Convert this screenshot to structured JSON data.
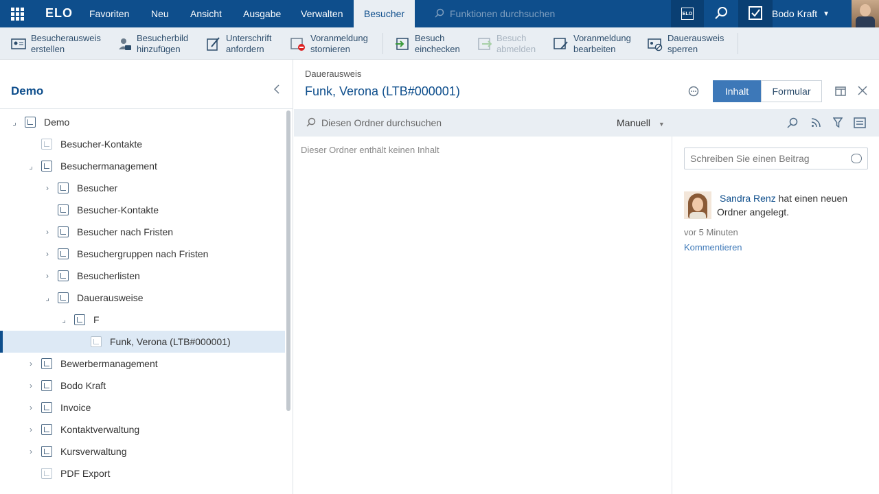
{
  "topbar": {
    "logo": "ELO",
    "menu": [
      "Favoriten",
      "Neu",
      "Ansicht",
      "Ausgabe",
      "Verwalten",
      "Besucher"
    ],
    "active_menu": "Besucher",
    "search_placeholder": "Funktionen durchsuchen",
    "elo_badge": "ELO",
    "user": "Bodo Kraft"
  },
  "toolbar": {
    "buttons": [
      {
        "label": "Besucherausweis\nerstellen",
        "enabled": true
      },
      {
        "label": "Besucherbild\nhinzufügen",
        "enabled": true
      },
      {
        "label": "Unterschrift\nanfordern",
        "enabled": true
      },
      {
        "label": "Voranmeldung\nstornieren",
        "enabled": true
      },
      {
        "label": "Besuch\neinchecken",
        "enabled": true
      },
      {
        "label": "Besuch\nabmelden",
        "enabled": false
      },
      {
        "label": "Voranmeldung\nbearbeiten",
        "enabled": true
      },
      {
        "label": "Dauerausweis\nsperren",
        "enabled": true
      }
    ]
  },
  "left": {
    "title": "Demo",
    "tree": [
      {
        "label": "Demo",
        "expanded": true
      },
      {
        "label": "Besucher-Kontakte"
      },
      {
        "label": "Besuchermanagement",
        "expanded": true
      },
      {
        "label": "Besucher",
        "expandable": true
      },
      {
        "label": "Besucher-Kontakte"
      },
      {
        "label": "Besucher nach Fristen",
        "expandable": true
      },
      {
        "label": "Besuchergruppen nach Fristen",
        "expandable": true
      },
      {
        "label": "Besucherlisten",
        "expandable": true
      },
      {
        "label": "Dauerausweise",
        "expanded": true
      },
      {
        "label": "F",
        "expanded": true
      },
      {
        "label": "Funk, Verona (LTB#000001)",
        "selected": true
      },
      {
        "label": "Bewerbermanagement",
        "expandable": true
      },
      {
        "label": "Bodo Kraft",
        "expandable": true
      },
      {
        "label": "Invoice",
        "expandable": true
      },
      {
        "label": "Kontaktverwaltung",
        "expandable": true
      },
      {
        "label": "Kursverwaltung",
        "expandable": true
      },
      {
        "label": "PDF Export"
      }
    ]
  },
  "center": {
    "breadcrumb": "Dauerausweis",
    "title": "Funk, Verona (LTB#000001)",
    "tab_content": "Inhalt",
    "tab_form": "Formular",
    "search_placeholder": "Diesen Ordner durchsuchen",
    "sort_label": "Manuell",
    "empty_text": "Dieser Ordner enthält keinen Inhalt"
  },
  "feed": {
    "input_placeholder": "Schreiben Sie einen Beitrag",
    "author": "Sandra Renz",
    "text_part": "hat einen neuen Ordner angelegt.",
    "time": "vor 5 Minuten",
    "comment_link": "Kommentieren"
  }
}
